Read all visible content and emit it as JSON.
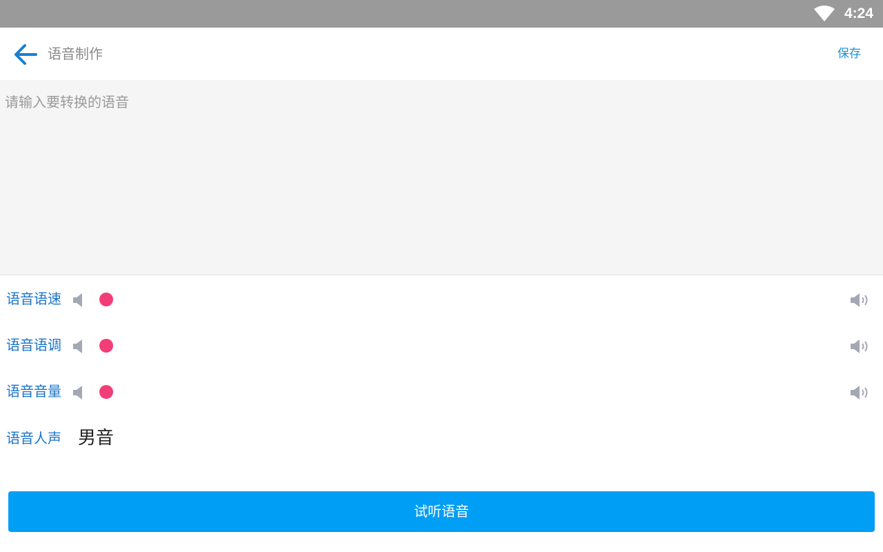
{
  "status_bar": {
    "time": "4:24",
    "wifi_icon": "wifi-icon"
  },
  "app_bar": {
    "back_icon": "arrow-left-icon",
    "title": "语音制作",
    "save_label": "保存"
  },
  "editor": {
    "placeholder": "请输入要转换的语音",
    "value": ""
  },
  "settings": {
    "speed": {
      "label": "语音语速",
      "level": 0,
      "low_icon": "volume-low-icon",
      "high_icon": "volume-high-icon"
    },
    "pitch": {
      "label": "语音语调",
      "level": 0,
      "low_icon": "volume-low-icon",
      "high_icon": "volume-high-icon"
    },
    "volume": {
      "label": "语音音量",
      "level": 0,
      "low_icon": "volume-low-icon",
      "high_icon": "volume-high-icon"
    },
    "voice": {
      "label": "语音人声",
      "value": "男音"
    }
  },
  "actions": {
    "listen_label": "试听语音"
  },
  "colors": {
    "status_bar": "#9a9a9a",
    "accent": "#1a74c8",
    "button": "#009ef5",
    "thumb": "#f23d78"
  }
}
